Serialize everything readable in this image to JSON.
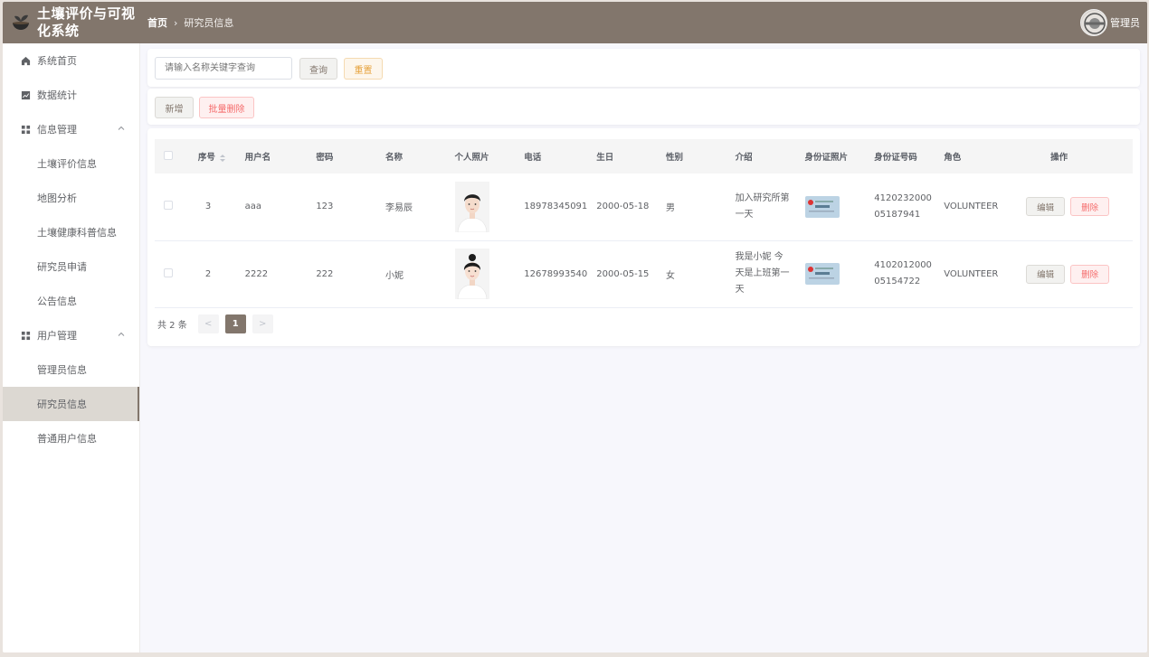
{
  "app": {
    "title": "土壤评价与可视化系统",
    "user": "管理员"
  },
  "breadcrumb": {
    "home": "首页",
    "current": "研究员信息"
  },
  "sidebar": {
    "home": "系统首页",
    "stats": "数据统计",
    "info_group": "信息管理",
    "info_items": [
      "土壤评价信息",
      "地图分析",
      "土壤健康科普信息",
      "研究员申请",
      "公告信息"
    ],
    "user_group": "用户管理",
    "user_items": [
      "管理员信息",
      "研究员信息",
      "普通用户信息"
    ]
  },
  "search": {
    "placeholder": "请输入名称关键字查询",
    "query": "查询",
    "reset": "重置"
  },
  "actions": {
    "add": "新增",
    "batch_delete": "批量删除"
  },
  "table": {
    "headers": [
      "序号",
      "用户名",
      "密码",
      "名称",
      "个人照片",
      "电话",
      "生日",
      "性别",
      "介绍",
      "身份证照片",
      "身份证号码",
      "角色",
      "操作"
    ],
    "rows": [
      {
        "id": "3",
        "username": "aaa",
        "password": "123",
        "name": "李易辰",
        "phone": "18978345091",
        "birthday": "2000-05-18",
        "gender": "男",
        "intro": "加入研究所第一天",
        "idno": "412023200005187941",
        "role": "VOLUNTEER"
      },
      {
        "id": "2",
        "username": "2222",
        "password": "222",
        "name": "小妮",
        "phone": "12678993540",
        "birthday": "2000-05-15",
        "gender": "女",
        "intro": "我是小妮 今天是上班第一天",
        "idno": "410201200005154722",
        "role": "VOLUNTEER"
      }
    ],
    "edit": "编辑",
    "delete": "删除"
  },
  "pager": {
    "total": "共 2 条",
    "page": "1",
    "prev": "<",
    "next": ">"
  },
  "colors": {
    "brand": "#82766c",
    "danger": "#f56c6c",
    "warning": "#e6a23c"
  }
}
